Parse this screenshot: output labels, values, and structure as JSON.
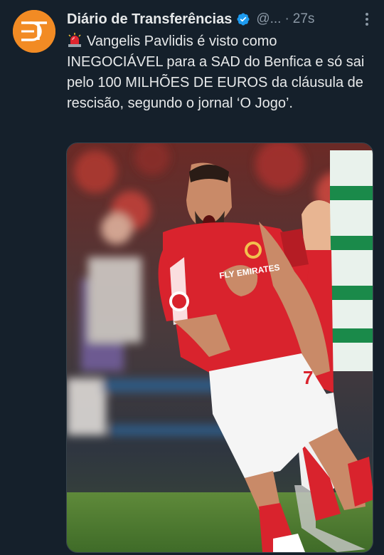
{
  "tweet": {
    "author_name": "Diário de Transferências",
    "handle": "@...",
    "separator": "·",
    "time": "27s",
    "text": "Vangelis Pavlidis é visto como INEGOCIÁVEL para a SAD do Benfica e só sai pelo 100 MILHÕES DE EUROS da cláusula de rescisão, segundo o jornal ‘O Jogo’.",
    "avatar_text": "DT",
    "icons": {
      "verified": "verified-badge-icon",
      "more": "more-options-icon",
      "emoji": "siren-emoji-icon"
    }
  },
  "media": {
    "jersey_text": "FLY EMIRATES",
    "shorts_number": "7"
  },
  "colors": {
    "background": "#15202b",
    "accent_avatar": "#f28b24",
    "verified": "#1d9bf0",
    "benfica_red": "#d9232d"
  }
}
